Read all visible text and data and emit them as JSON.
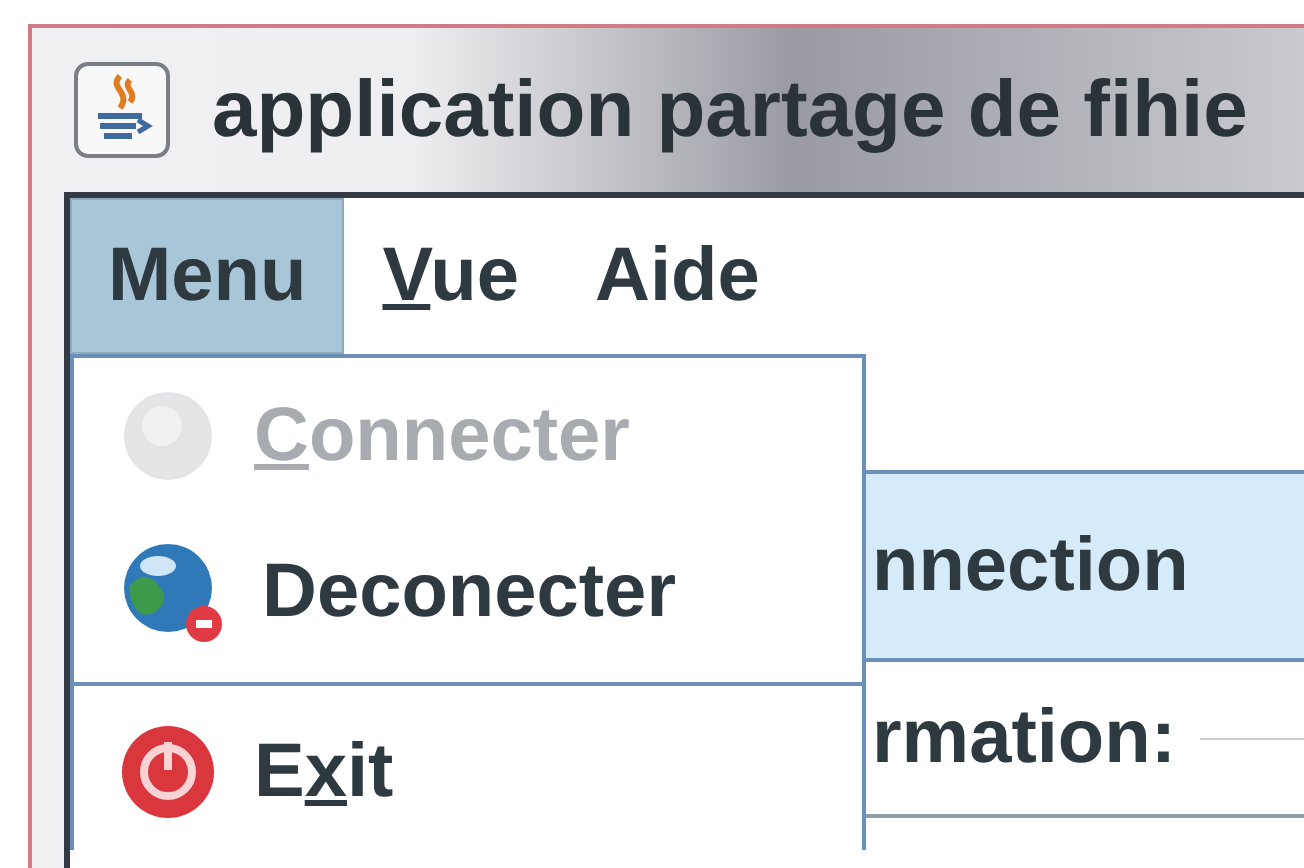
{
  "window": {
    "title": "application partage de fihie"
  },
  "menu_bar": [
    {
      "label": "Menu",
      "selected": true
    },
    {
      "mnemonic": "V",
      "rest": "ue",
      "selected": false
    },
    {
      "label": "Aide",
      "selected": false
    }
  ],
  "menu": {
    "items": [
      {
        "kind": "globe",
        "mnemonic": "C",
        "rest": "onnecter",
        "disabled": true
      },
      {
        "kind": "badged",
        "label": "Deconecter",
        "disabled": false
      },
      {
        "kind": "separator"
      },
      {
        "kind": "power",
        "lead": "E",
        "mnemonic": "x",
        "rest": "it",
        "disabled": false
      }
    ]
  },
  "panel": {
    "tab": {
      "label": "nnection",
      "selected": true
    },
    "field_label": "rmation:"
  }
}
